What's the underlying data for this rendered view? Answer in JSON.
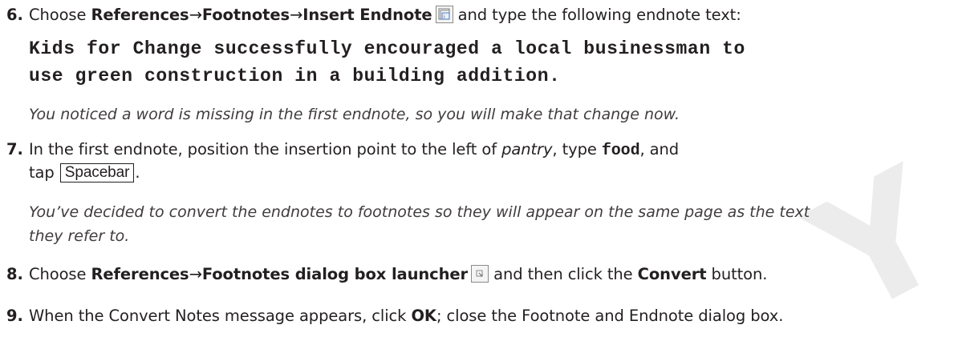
{
  "watermark": {
    "letter": "Y",
    "color": "#ececec"
  },
  "steps": [
    {
      "number": "6.",
      "pre": "Choose ",
      "menu1": "References",
      "arrow1": "→",
      "menu2": "Footnotes",
      "arrow2": "→",
      "menu3": "Insert Endnote",
      "icon": "insert-endnote-icon",
      "post": " and type the following endnote text:",
      "code_line1": "Kids for Change successfully encouraged a local businessman to",
      "code_line2": "use green construction in a building addition.",
      "note": "You noticed a word is missing in the first endnote, so you will make that change now."
    },
    {
      "number": "7.",
      "pre": "In the first endnote, position the insertion point to the left of ",
      "italic_word": "pantry",
      "mid": ", type ",
      "code_word": "food",
      "post": ", and",
      "line2_pre": "tap ",
      "key": "Spacebar",
      "line2_post": ".",
      "note_line1": "You’ve decided to convert the endnotes to footnotes so they will appear on the same page as the text",
      "note_line2": "they refer to."
    },
    {
      "number": "8.",
      "pre": "Choose ",
      "menu1": "References",
      "arrow1": "→",
      "menu2": "Footnotes dialog box launcher",
      "icon": "dialog-launcher-icon",
      "mid": " and then click the ",
      "bold_word": "Convert",
      "post": " button."
    },
    {
      "number": "9.",
      "pre": "When the Convert Notes message appears, click ",
      "bold_word": "OK",
      "post": "; close the Footnote and Endnote dialog box."
    }
  ]
}
